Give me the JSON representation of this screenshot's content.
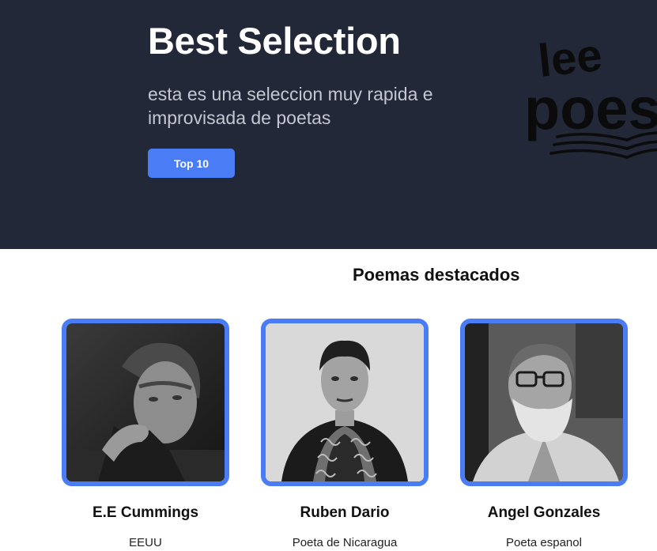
{
  "hero": {
    "title": "Best Selection",
    "subtitle": "esta es una seleccion muy rapida e improvisada de poetas",
    "button_label": "Top 10",
    "logo_text_line1": "lee",
    "logo_text_line2": "poes"
  },
  "featured": {
    "title": "Poemas destacados",
    "cards": [
      {
        "name": "E.E Cummings",
        "description": "EEUU"
      },
      {
        "name": "Ruben Dario",
        "description": "Poeta de Nicaragua"
      },
      {
        "name": "Angel Gonzales",
        "description": "Poeta espanol"
      }
    ]
  },
  "colors": {
    "hero_background": "#222838",
    "accent": "#4a7cf6",
    "hero_text": "#ffffff",
    "hero_subtext": "#c4c7d0"
  }
}
